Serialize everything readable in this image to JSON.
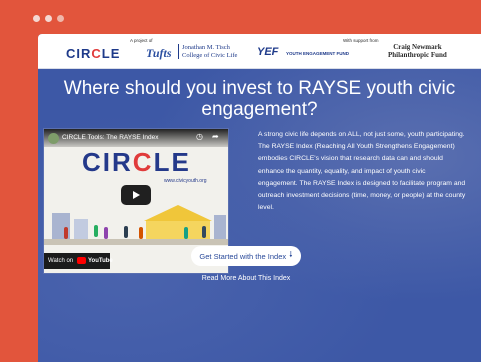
{
  "window": {
    "controls": [
      "close",
      "minimize",
      "maximize"
    ]
  },
  "logos_bar": {
    "project_label": "A project of",
    "support_label": "With support from",
    "circle": {
      "pre": "CIR",
      "mid": "C",
      "post": "LE"
    },
    "tufts": "Tufts",
    "tisch_line1": "Jonathan M. Tisch",
    "tisch_line2": "College of Civic Life",
    "yef": "YEF",
    "yef_sub": "YOUTH ENGAGEMENT FUND",
    "craig_line1": "Craig Newmark",
    "craig_line2": "Philanthropic Fund"
  },
  "hero": {
    "headline": "Where should you invest to RAYSE youth civic engagement?",
    "video": {
      "title": "CIRCLE Tools: The RAYSE Index",
      "logo": {
        "pre": "CIR",
        "mid": "C",
        "post": "LE"
      },
      "url": "www.civicyouth.org",
      "watch_on": "Watch on",
      "youtube": "YouTube"
    },
    "description": "A strong civic life depends on ALL, not just some, youth participating. The RAYSE Index (Reaching All Youth Strengthens Engagement) embodies CIRCLE's vision that research data can and should enhance the quantity, equality, and impact of youth civic engagement. The RAYSE Index is designed to facilitate program and outreach investment decisions (time, money, or people) at the county level.",
    "cta_label": "Get Started with the Index",
    "more_link": "Read More About This Index"
  },
  "colors": {
    "frame": "#e2553c",
    "hero": "#3d58a6",
    "brand_blue": "#1e3a8a",
    "brand_red": "#e03b3b"
  }
}
